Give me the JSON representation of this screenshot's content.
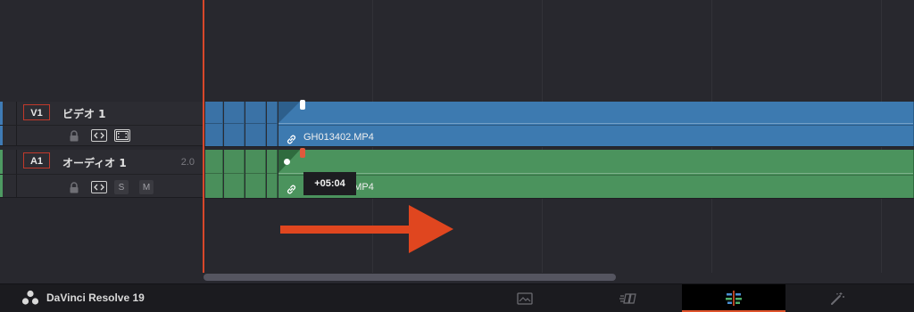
{
  "app": {
    "name": "DaVinci Resolve 19"
  },
  "tracks": [
    {
      "id": "V1",
      "name": "ビデオ 1",
      "kind": "video"
    },
    {
      "id": "A1",
      "name": "オーディオ 1",
      "kind": "audio",
      "level": "2.0"
    }
  ],
  "audio_buttons": {
    "solo": "S",
    "mute": "M"
  },
  "clips": {
    "video_name": "GH013402.MP4",
    "audio_name": "GH013402.MP4"
  },
  "trim_tooltip": "+05:04",
  "page_tabs": [
    {
      "name": "media-page",
      "icon": "media-icon",
      "active": false
    },
    {
      "name": "cut-page",
      "icon": "cut-icon",
      "active": false
    },
    {
      "name": "edit-page",
      "icon": "edit-timeline-icon",
      "active": true
    },
    {
      "name": "fusion-page",
      "icon": "fusion-wand-icon",
      "active": false
    }
  ],
  "colors": {
    "video_clip": "#3d7ab0",
    "audio_clip": "#4b935d",
    "playhead": "#d8472a",
    "annotation_arrow": "#e0461f",
    "track_id_border": "#c0392b"
  }
}
